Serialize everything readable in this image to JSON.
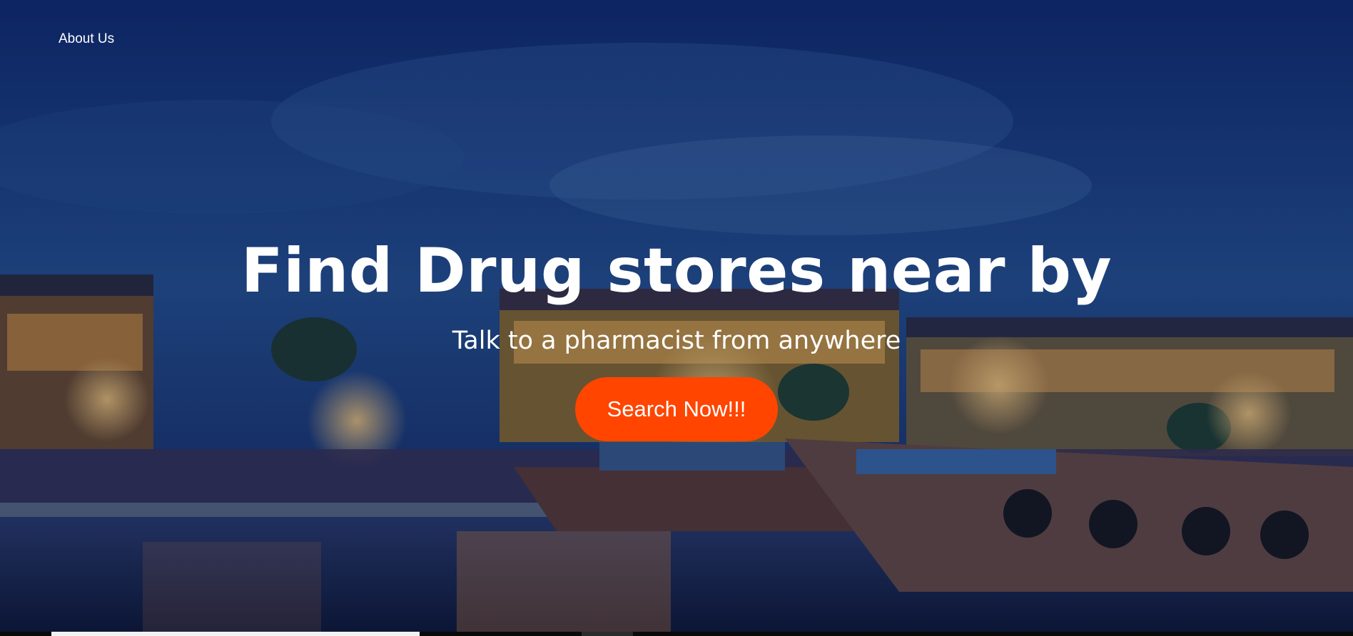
{
  "nav": {
    "about_label": "About Us"
  },
  "hero": {
    "headline": "Find Drug stores near by",
    "subheadline": "Talk to a pharmacist from anywhere",
    "cta_label": "Search Now!!!",
    "background": "hoi-an-river-night-scene"
  },
  "colors": {
    "accent": "#ff4500",
    "overlay": "#0b2a6b",
    "text": "#ffffff"
  }
}
